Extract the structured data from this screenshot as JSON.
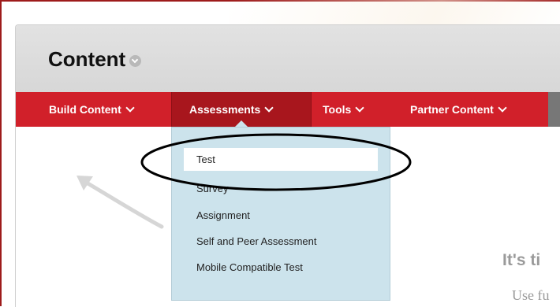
{
  "header": {
    "title": "Content"
  },
  "menubar": {
    "items": [
      {
        "label": "Build Content"
      },
      {
        "label": "Assessments"
      },
      {
        "label": "Tools"
      },
      {
        "label": "Partner Content"
      }
    ]
  },
  "dropdown": {
    "items": [
      "Test",
      "Survey",
      "Assignment",
      "Self and Peer Assessment",
      "Mobile Compatible Test"
    ],
    "selected": "Test"
  },
  "empty_state": {
    "heading": "It's ti",
    "body": "Use fu"
  },
  "colors": {
    "menubar": "#d1202a",
    "active_menu": "#a8161d",
    "dropdown_bg": "#cce3ec",
    "frame_border": "#9e1b1b"
  },
  "icons": [
    "title-chevron-icon",
    "chevron-down-icon",
    "curved-arrow-icon",
    "highlight-ellipse"
  ]
}
